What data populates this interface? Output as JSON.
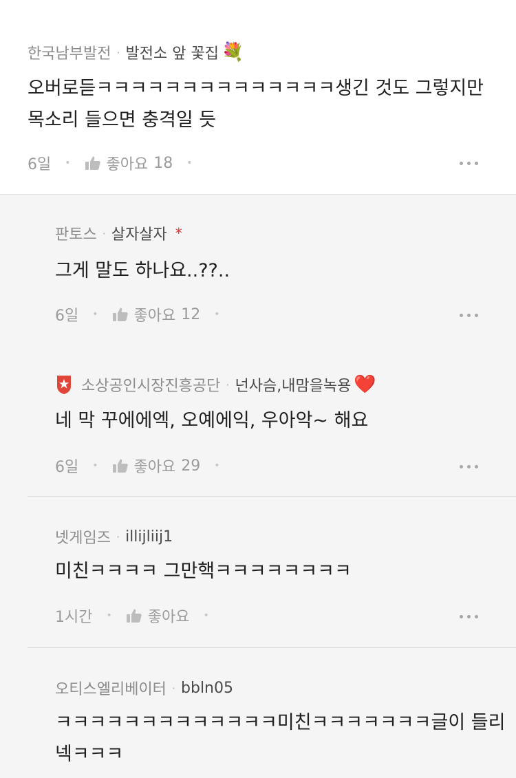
{
  "comments": [
    {
      "org": "한국남부발전",
      "nick": "발전소 앞 꽃집",
      "emoji": "💐",
      "text_lines": [
        "오버로듣ㅋㅋㅋㅋㅋㅋㅋㅋㅋㅋㅋㅋㅋㅋ생긴 것도 그렇지만",
        "목소리 들으면 충격일 듯"
      ],
      "time": "6일",
      "like_label": "좋아요",
      "like_count": "18"
    },
    {
      "org": "판토스",
      "nick": "살자살자",
      "mark": "*",
      "text_lines": [
        "그게 말도 하나요..??.."
      ],
      "time": "6일",
      "like_label": "좋아요",
      "like_count": "12"
    },
    {
      "org": "소상공인시장진흥공단",
      "nick": "넌사슴,내맘을녹용",
      "emoji": "❤️",
      "badge_icon": "shield-star-icon",
      "text_lines": [
        "네 막 꾸에에엑, 오예에익, 우아악~ 해요"
      ],
      "time": "6일",
      "like_label": "좋아요",
      "like_count": "29"
    },
    {
      "org": "넷게임즈",
      "nick": "illijliij1",
      "text_lines": [
        "미친ㅋㅋㅋㅋ 그만핵ㅋㅋㅋㅋㅋㅋㅋㅋ"
      ],
      "time": "1시간",
      "like_label": "좋아요",
      "like_count": ""
    },
    {
      "org": "오티스엘리베이터",
      "nick": "bbln05",
      "text_lines": [
        "ㅋㅋㅋㅋㅋㅋㅋㅋㅋㅋㅋㅋㅋ미친ㅋㅋㅋㅋㅋㅋㅋ글이 들리",
        "넥ㅋㅋㅋ"
      ]
    }
  ],
  "colors": {
    "accent_red": "#e02a2a",
    "background": "#f5f5f5",
    "top_background": "#ffffff"
  }
}
